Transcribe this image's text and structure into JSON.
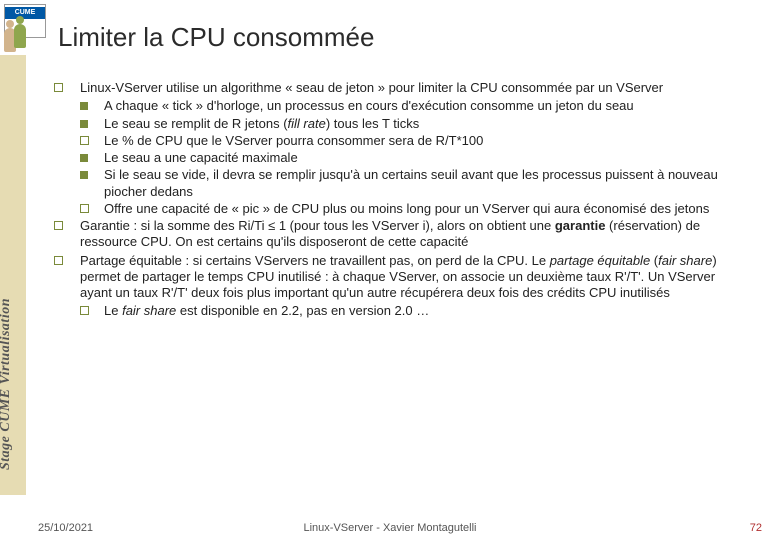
{
  "logo_text": "CUME",
  "title": "Limiter la CPU consommée",
  "side_label": "Stage CUME Virtualisation",
  "bul": {
    "open": "",
    "fill": ""
  },
  "items": [
    {
      "text": "Linux-VServer utilise un algorithme « seau de jeton » pour limiter la CPU consommée par un VServer",
      "children": [
        {
          "mark": "fill",
          "text": "A chaque « tick » d'horloge, un processus en cours d'exécution consomme un jeton du seau"
        },
        {
          "mark": "fill",
          "text_html": "Le seau se remplit de R jetons (<span class='i'>fill rate</span>) tous les T ticks"
        },
        {
          "mark": "open",
          "text": "Le % de CPU que le VServer pourra consommer sera de R/T*100"
        },
        {
          "mark": "fill",
          "text": "Le seau a une capacité maximale"
        },
        {
          "mark": "fill",
          "text": "Si le seau se vide, il devra se remplir jusqu'à un certains seuil avant que les processus puissent à nouveau piocher dedans"
        },
        {
          "mark": "open",
          "text": "Offre une capacité de « pic » de CPU plus ou moins long pour un VServer qui aura économisé des jetons"
        }
      ]
    },
    {
      "text_html": "Garantie : si la somme des Ri/Ti ≤ 1 (pour tous les VServer i), alors on obtient une <span class='b'>garantie</span> (réservation) de ressource CPU. On est certains qu'ils disposeront de cette capacité"
    },
    {
      "text_html": "Partage équitable : si certains VServers ne travaillent pas, on perd de la CPU. Le <span class='i'>partage équitable</span> (<span class='i'>fair share</span>) permet de partager le temps CPU inutilisé : à chaque VServer, on associe un deuxième taux R'/T'. Un VServer ayant un taux R'/T' deux fois plus important qu'un autre récupérera deux fois des crédits CPU inutilisés",
      "children": [
        {
          "mark": "open",
          "text_html": "Le <span class='i'>fair share</span> est disponible en 2.2, pas en version 2.0 …"
        }
      ]
    }
  ],
  "footer": {
    "date": "25/10/2021",
    "middle": "Linux-VServer - Xavier Montagutelli",
    "page": "72"
  }
}
